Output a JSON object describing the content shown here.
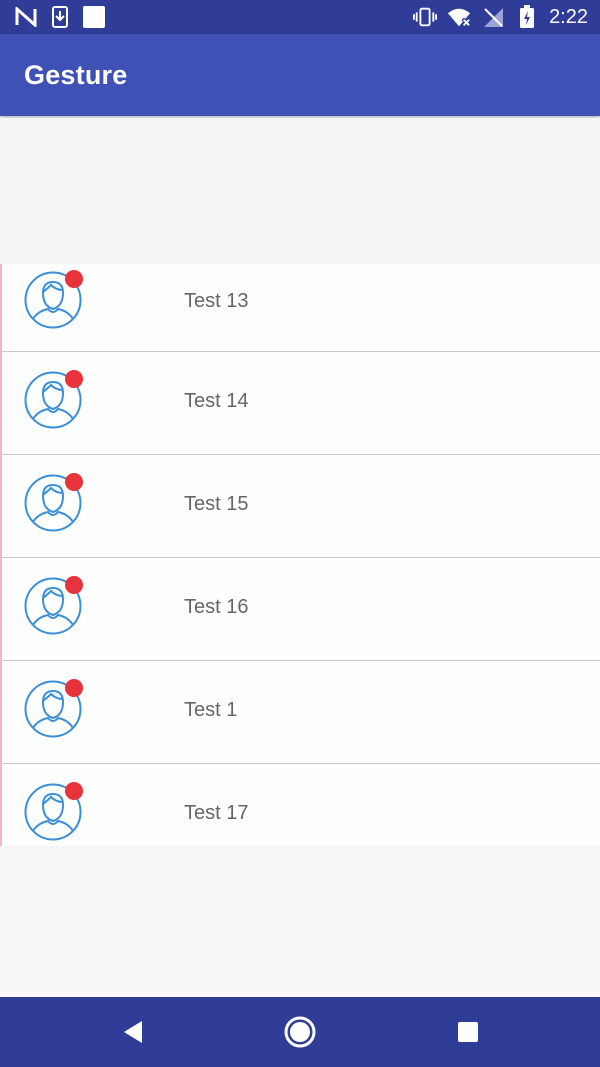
{
  "status_bar": {
    "time": "2:22",
    "left_icons": [
      "n-icon",
      "download-icon",
      "square-icon"
    ],
    "right_icons": [
      "vibrate-icon",
      "wifi-off-icon",
      "signal-off-icon",
      "battery-charging-icon"
    ]
  },
  "app_bar": {
    "title": "Gesture"
  },
  "list": {
    "items": [
      {
        "label": "Test 13",
        "icon": "user-avatar-icon"
      },
      {
        "label": "Test 14",
        "icon": "user-avatar-icon"
      },
      {
        "label": "Test 15",
        "icon": "user-avatar-icon"
      },
      {
        "label": "Test 16",
        "icon": "user-avatar-icon"
      },
      {
        "label": "Test 1",
        "icon": "user-avatar-icon"
      },
      {
        "label": "Test 17",
        "icon": "user-avatar-icon"
      }
    ]
  },
  "nav_bar": {
    "buttons": [
      "back-icon",
      "home-icon",
      "recents-icon"
    ]
  },
  "colors": {
    "primary": "#3f51b5",
    "primary_dark": "#2f3d98",
    "badge": "#e8323c",
    "avatar_stroke": "#3b8fd6"
  }
}
